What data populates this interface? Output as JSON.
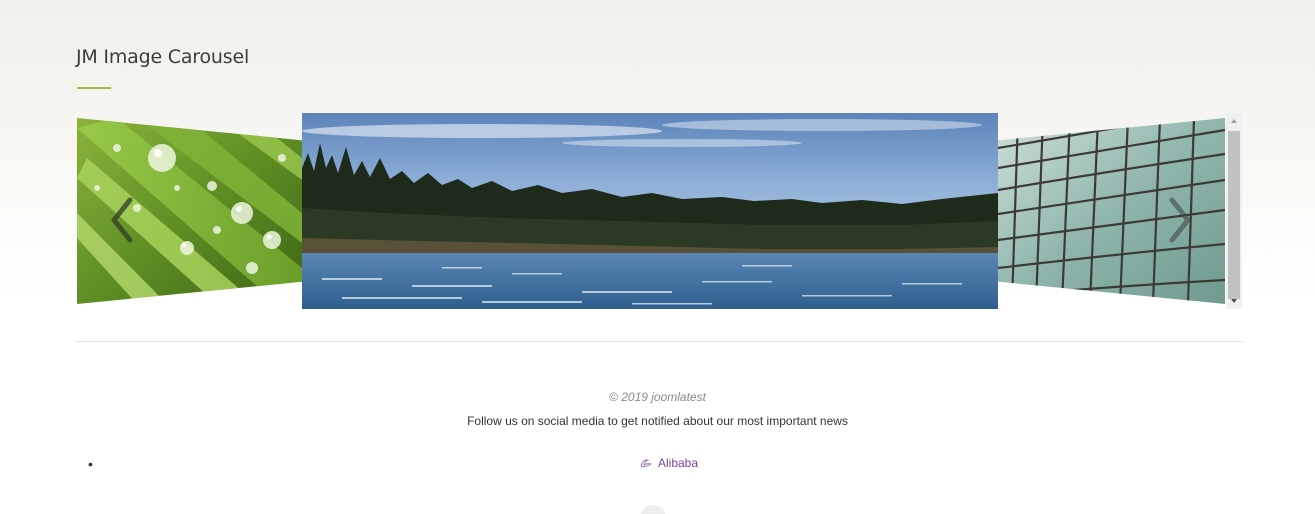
{
  "module": {
    "title": "JM Image Carousel",
    "accent_color": "#a4ba4f"
  },
  "carousel": {
    "slides": [
      {
        "position": "left",
        "subject": "water-drops-on-grass"
      },
      {
        "position": "center",
        "subject": "lake-with-forest"
      },
      {
        "position": "right",
        "subject": "glass-building-facade"
      }
    ],
    "prev_icon": "chevron-left-icon",
    "next_icon": "chevron-right-icon"
  },
  "footer": {
    "copyright": "© 2019 joomlatest",
    "follow_text": "Follow us on social media to get notified about our most important news",
    "social_links": [
      {
        "label": "Alibaba",
        "icon": "alibaba-icon",
        "color": "#7b42a3"
      }
    ]
  }
}
